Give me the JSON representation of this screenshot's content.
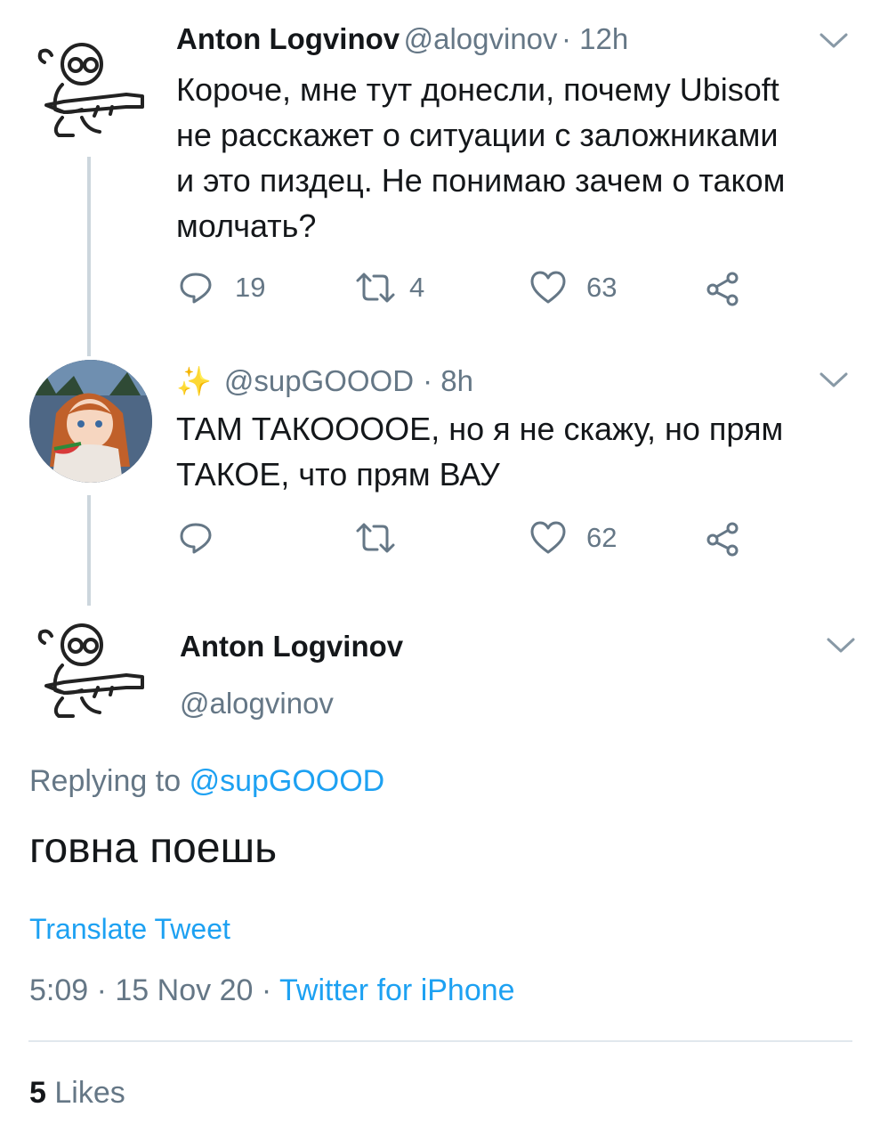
{
  "tweet1": {
    "author_name": "Anton Logvinov",
    "handle": "@alogvinov",
    "time": "· 12h",
    "lines": [
      "Короче, мне тут донесли, почему Ubisoft",
      "не расскажет о ситуации с заложниками",
      "и это пиздец. Не понимаю зачем о таком",
      "молчать?"
    ],
    "replies": "19",
    "retweets": "4",
    "likes": "63"
  },
  "tweet2": {
    "sparkle": "✨",
    "handle": "@supGOOOD",
    "time": "· 8h",
    "lines": [
      "ТАМ ТАКОООOE, но я не скажу, но прям",
      "ТАКОЕ, что прям ВАУ"
    ],
    "likes": "62"
  },
  "main_tweet": {
    "author_name": "Anton Logvinov",
    "handle": "@alogvinov",
    "replying_prefix": "Replying to",
    "replying_handle": "@supGOOOD",
    "text": "говна поешь",
    "translate": "Translate Tweet",
    "timestamp": "5:09 · 15 Nov 20 ·",
    "source": "Twitter for iPhone",
    "likes_count": "5",
    "likes_label": "Likes"
  },
  "icons": {
    "reply": "reply-icon",
    "retweet": "retweet-icon",
    "like": "heart-icon",
    "share": "share-icon",
    "more": "chevron-down-icon"
  },
  "colors": {
    "link": "#1da1f2",
    "muted": "#657786",
    "text": "#14171a",
    "thread_line": "#ccd6dd"
  }
}
